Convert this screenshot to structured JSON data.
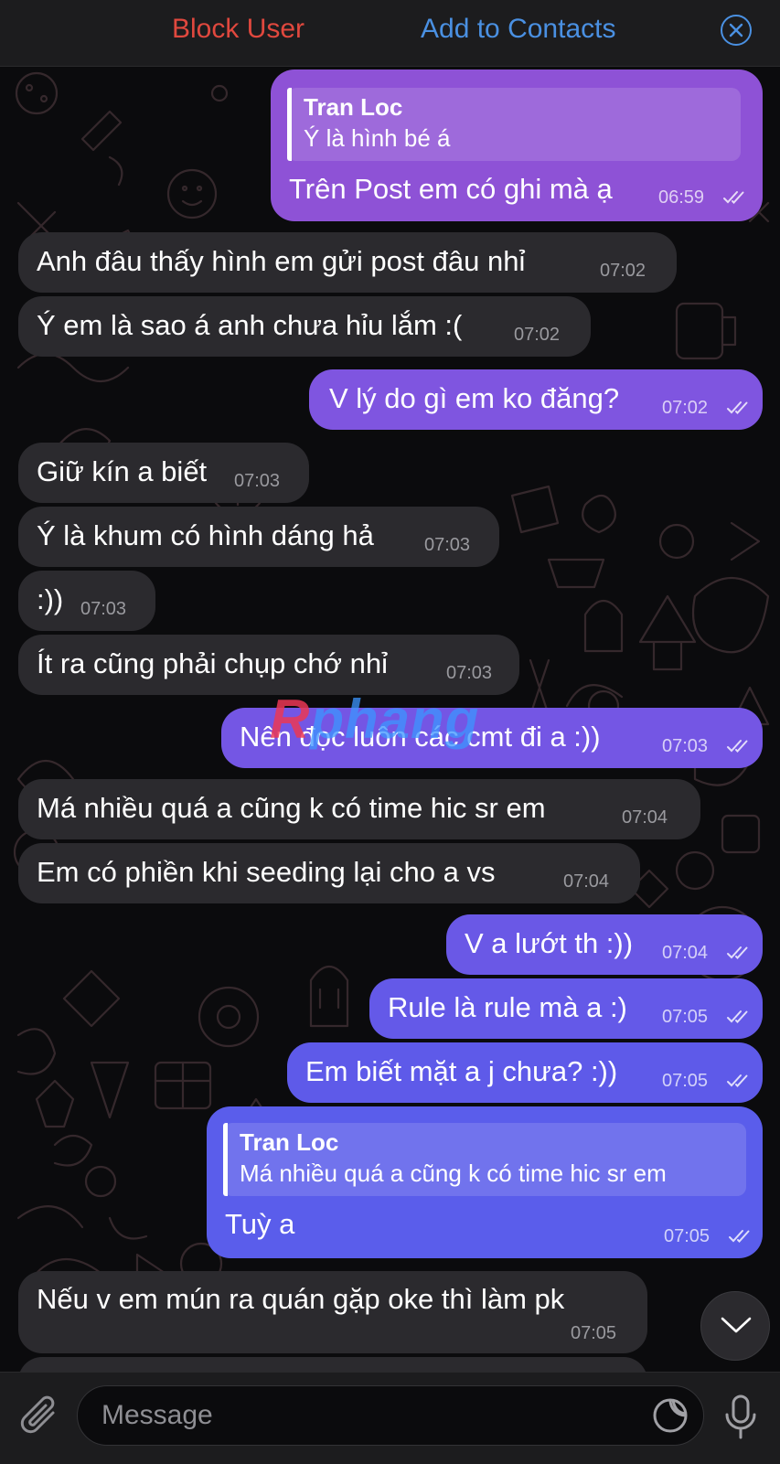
{
  "header": {
    "block_label": "Block User",
    "add_label": "Add to Contacts",
    "close_icon": "close-circle-icon",
    "accent_color": "#4a90e2",
    "danger_color": "#e0483e"
  },
  "messages": [
    {
      "dir": "out",
      "reply_name": "Tran Loc",
      "reply_text": "Ý là hình bé á",
      "text": "Trên Post em có ghi mà ạ",
      "time": "06:59"
    },
    {
      "dir": "in",
      "text": "Anh đâu thấy hình em gửi post đâu nhỉ",
      "time": "07:02"
    },
    {
      "dir": "in",
      "text": "Ý em là sao á anh chưa hỉu lắm :(",
      "time": "07:02"
    },
    {
      "dir": "out",
      "text": "V lý do gì em ko đăng?",
      "time": "07:02"
    },
    {
      "dir": "in",
      "text": "Giữ kín a biết",
      "time": "07:03"
    },
    {
      "dir": "in",
      "text": "Ý là khum có hình dáng hả",
      "time": "07:03"
    },
    {
      "dir": "in",
      "text": ":))",
      "time": "07:03"
    },
    {
      "dir": "in",
      "text": "Ít ra cũng phải chụp chớ nhỉ",
      "time": "07:03"
    },
    {
      "dir": "out",
      "text": "Nên đọc luôn các cmt đi a :))",
      "time": "07:03"
    },
    {
      "dir": "in",
      "text": "Má nhiều quá a cũng k có time hic sr em",
      "time": "07:04"
    },
    {
      "dir": "in",
      "text": "Em có phiền khi seeding lại cho a vs",
      "time": "07:04"
    },
    {
      "dir": "out",
      "text": "V a lướt th :))",
      "time": "07:04"
    },
    {
      "dir": "out",
      "text": "Rule là rule mà a :)",
      "time": "07:05"
    },
    {
      "dir": "out",
      "text": "Em biết mặt a j chưa? :))",
      "time": "07:05"
    },
    {
      "dir": "out",
      "reply_name": "Tran Loc",
      "reply_text": "Má nhiều quá a cũng k có time hic sr em",
      "text": "Tuỳ a",
      "time": "07:05"
    },
    {
      "dir": "in",
      "text": "Nếu v em mún ra quán gặp oke thì làm pk",
      "time": "07:05"
    }
  ],
  "watermark": {
    "first": "R",
    "rest": "phang"
  },
  "composer": {
    "placeholder": "Message",
    "attach_icon": "paperclip-icon",
    "sticker_icon": "sticker-icon",
    "mic_icon": "microphone-icon",
    "scroll_icon": "chevron-down-icon"
  }
}
